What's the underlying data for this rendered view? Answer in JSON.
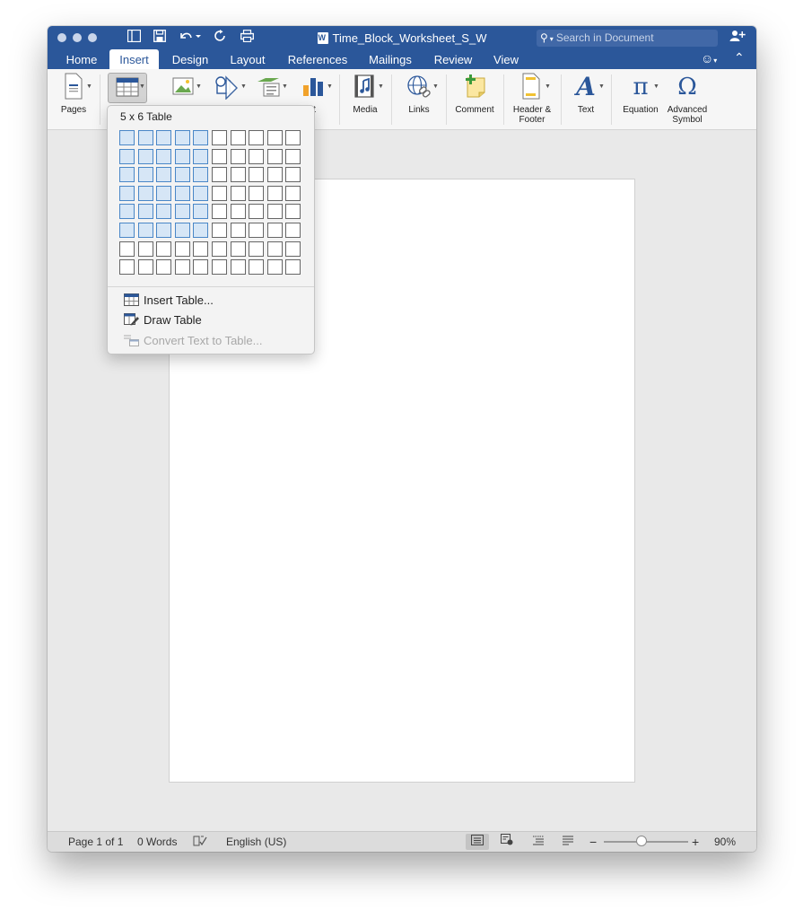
{
  "window": {
    "title": "Time_Block_Worksheet_S_W",
    "search_placeholder": "Search in Document"
  },
  "tabs": [
    "Home",
    "Insert",
    "Design",
    "Layout",
    "References",
    "Mailings",
    "Review",
    "View"
  ],
  "active_tab": "Insert",
  "ribbon": {
    "pages": "Pages",
    "chart_partial": "rt",
    "media": "Media",
    "links": "Links",
    "comment": "Comment",
    "header_footer_1": "Header &",
    "header_footer_2": "Footer",
    "text": "Text",
    "equation": "Equation",
    "symbol_1": "Advanced",
    "symbol_2": "Symbol"
  },
  "table_menu": {
    "size_label": "5 x 6 Table",
    "grid_columns": 10,
    "grid_rows": 8,
    "selected_columns": 5,
    "selected_rows": 6,
    "insert_table": "Insert Table...",
    "draw_table": "Draw Table",
    "convert_text": "Convert Text to Table..."
  },
  "status": {
    "page": "Page 1 of 1",
    "words": "0 Words",
    "language": "English (US)",
    "zoom": "90%",
    "zoom_percent": 90
  },
  "colors": {
    "brand": "#2b579a",
    "grid_selected": "#d6e6f6",
    "grid_selected_border": "#4a87c7"
  }
}
